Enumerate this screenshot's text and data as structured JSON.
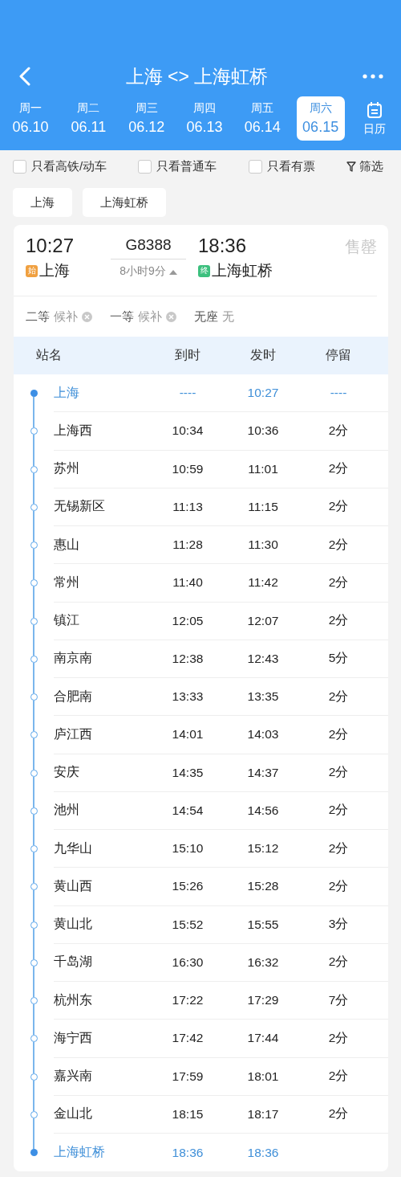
{
  "header": {
    "title": "上海 <> 上海虹桥"
  },
  "dates": [
    {
      "weekday": "周一",
      "date": "06.10",
      "selected": false
    },
    {
      "weekday": "周二",
      "date": "06.11",
      "selected": false
    },
    {
      "weekday": "周三",
      "date": "06.12",
      "selected": false
    },
    {
      "weekday": "周四",
      "date": "06.13",
      "selected": false
    },
    {
      "weekday": "周五",
      "date": "06.14",
      "selected": false
    },
    {
      "weekday": "周六",
      "date": "06.15",
      "selected": true
    }
  ],
  "calendar": {
    "label": "日历"
  },
  "filters": [
    {
      "label": "只看高铁/动车",
      "checked": false
    },
    {
      "label": "只看普通车",
      "checked": false
    },
    {
      "label": "只看有票",
      "checked": false
    }
  ],
  "filter_button": {
    "label": "筛选"
  },
  "station_tabs": [
    {
      "label": "上海"
    },
    {
      "label": "上海虹桥"
    }
  ],
  "train": {
    "depart_time": "10:27",
    "number": "G8388",
    "arrive_time": "18:36",
    "status": "售罄",
    "from_badge": "始",
    "from": "上海",
    "duration": "8小时9分",
    "to_badge": "终",
    "to": "上海虹桥"
  },
  "seats": [
    {
      "class": "二等",
      "status": "候补",
      "kind": "waitlist"
    },
    {
      "class": "一等",
      "status": "候补",
      "kind": "waitlist"
    },
    {
      "class": "无座",
      "status": "无",
      "kind": "none"
    }
  ],
  "timetable": {
    "columns": [
      "站名",
      "到时",
      "发时",
      "停留"
    ],
    "stops": [
      {
        "station": "上海",
        "arrive": "----",
        "depart": "10:27",
        "stop": "----",
        "endpoint": true
      },
      {
        "station": "上海西",
        "arrive": "10:34",
        "depart": "10:36",
        "stop": "2分",
        "endpoint": false
      },
      {
        "station": "苏州",
        "arrive": "10:59",
        "depart": "11:01",
        "stop": "2分",
        "endpoint": false
      },
      {
        "station": "无锡新区",
        "arrive": "11:13",
        "depart": "11:15",
        "stop": "2分",
        "endpoint": false
      },
      {
        "station": "惠山",
        "arrive": "11:28",
        "depart": "11:30",
        "stop": "2分",
        "endpoint": false
      },
      {
        "station": "常州",
        "arrive": "11:40",
        "depart": "11:42",
        "stop": "2分",
        "endpoint": false
      },
      {
        "station": "镇江",
        "arrive": "12:05",
        "depart": "12:07",
        "stop": "2分",
        "endpoint": false
      },
      {
        "station": "南京南",
        "arrive": "12:38",
        "depart": "12:43",
        "stop": "5分",
        "endpoint": false
      },
      {
        "station": "合肥南",
        "arrive": "13:33",
        "depart": "13:35",
        "stop": "2分",
        "endpoint": false
      },
      {
        "station": "庐江西",
        "arrive": "14:01",
        "depart": "14:03",
        "stop": "2分",
        "endpoint": false
      },
      {
        "station": "安庆",
        "arrive": "14:35",
        "depart": "14:37",
        "stop": "2分",
        "endpoint": false
      },
      {
        "station": "池州",
        "arrive": "14:54",
        "depart": "14:56",
        "stop": "2分",
        "endpoint": false
      },
      {
        "station": "九华山",
        "arrive": "15:10",
        "depart": "15:12",
        "stop": "2分",
        "endpoint": false
      },
      {
        "station": "黄山西",
        "arrive": "15:26",
        "depart": "15:28",
        "stop": "2分",
        "endpoint": false
      },
      {
        "station": "黄山北",
        "arrive": "15:52",
        "depart": "15:55",
        "stop": "3分",
        "endpoint": false
      },
      {
        "station": "千岛湖",
        "arrive": "16:30",
        "depart": "16:32",
        "stop": "2分",
        "endpoint": false
      },
      {
        "station": "杭州东",
        "arrive": "17:22",
        "depart": "17:29",
        "stop": "7分",
        "endpoint": false
      },
      {
        "station": "海宁西",
        "arrive": "17:42",
        "depart": "17:44",
        "stop": "2分",
        "endpoint": false
      },
      {
        "station": "嘉兴南",
        "arrive": "17:59",
        "depart": "18:01",
        "stop": "2分",
        "endpoint": false
      },
      {
        "station": "金山北",
        "arrive": "18:15",
        "depart": "18:17",
        "stop": "2分",
        "endpoint": false
      },
      {
        "station": "上海虹桥",
        "arrive": "18:36",
        "depart": "18:36",
        "endpoint": true
      }
    ]
  }
}
